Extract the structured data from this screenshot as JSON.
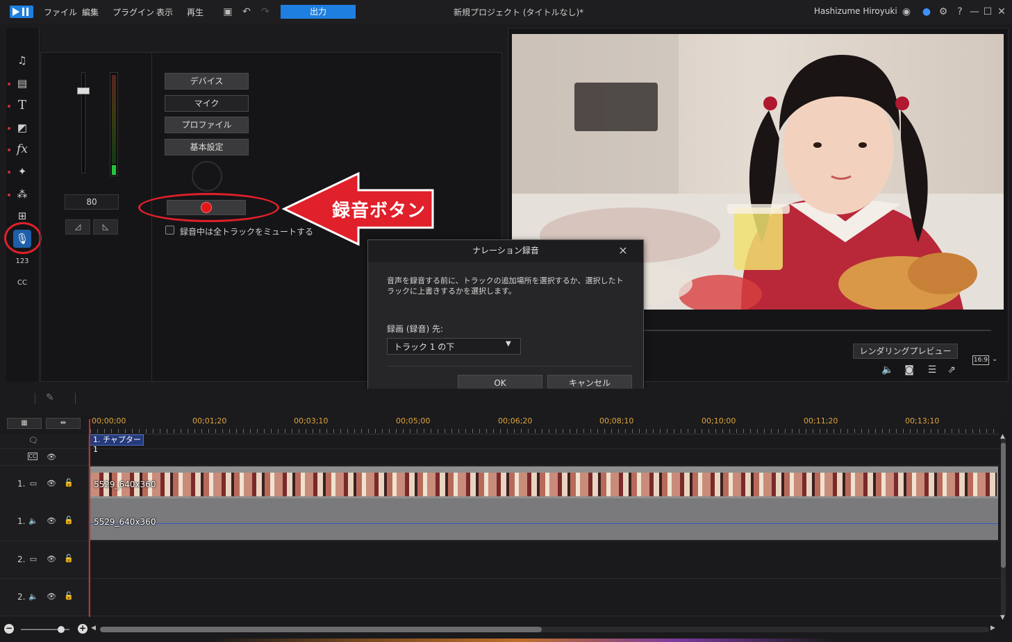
{
  "titlebar": {
    "menus": [
      "ファイル",
      "編集",
      "プラグイン",
      "表示",
      "再生"
    ],
    "export_label": "出力",
    "project_title": "新規プロジェクト (タイトルなし)*",
    "user_name": "Hashizume Hiroyuki"
  },
  "narration_panel": {
    "volume_value": "80",
    "buttons": [
      "デバイス",
      "マイク",
      "プロファイル",
      "基本設定"
    ],
    "mute_all_label": "録音中は全トラックをミュートする"
  },
  "callout": {
    "text": "録音ボタン"
  },
  "dialog": {
    "title": "ナレーション録音",
    "message": "音声を録音する前に、トラックの追加場所を選択するか、選択したトラックに上書きするかを選択します。",
    "destination_label": "録画 (録音) 先:",
    "destination_value": "トラック 1 の下",
    "ok_label": "OK",
    "cancel_label": "キャンセル"
  },
  "preview": {
    "render_preview_label": "レンダリングプレビュー",
    "aspect_ratio": "16:9"
  },
  "timeline": {
    "timecodes": [
      "00;00;00",
      "00;01;20",
      "00;03;10",
      "00;05;00",
      "00;06;20",
      "00;08;10",
      "00;10;00",
      "00;11;20",
      "00;13;10"
    ],
    "chapter_label": "1. チャプター 1",
    "tracks": [
      {
        "label": "1.",
        "type": "video"
      },
      {
        "label": "1.",
        "type": "audio"
      },
      {
        "label": "2.",
        "type": "video"
      },
      {
        "label": "2.",
        "type": "audio"
      }
    ],
    "video_clip_name": "5529_640x360",
    "audio_clip_name": "5529_640x360"
  },
  "colors": {
    "accent": "#1f7fe0",
    "highlight": "#e0202a",
    "playhead": "#d0282a"
  }
}
